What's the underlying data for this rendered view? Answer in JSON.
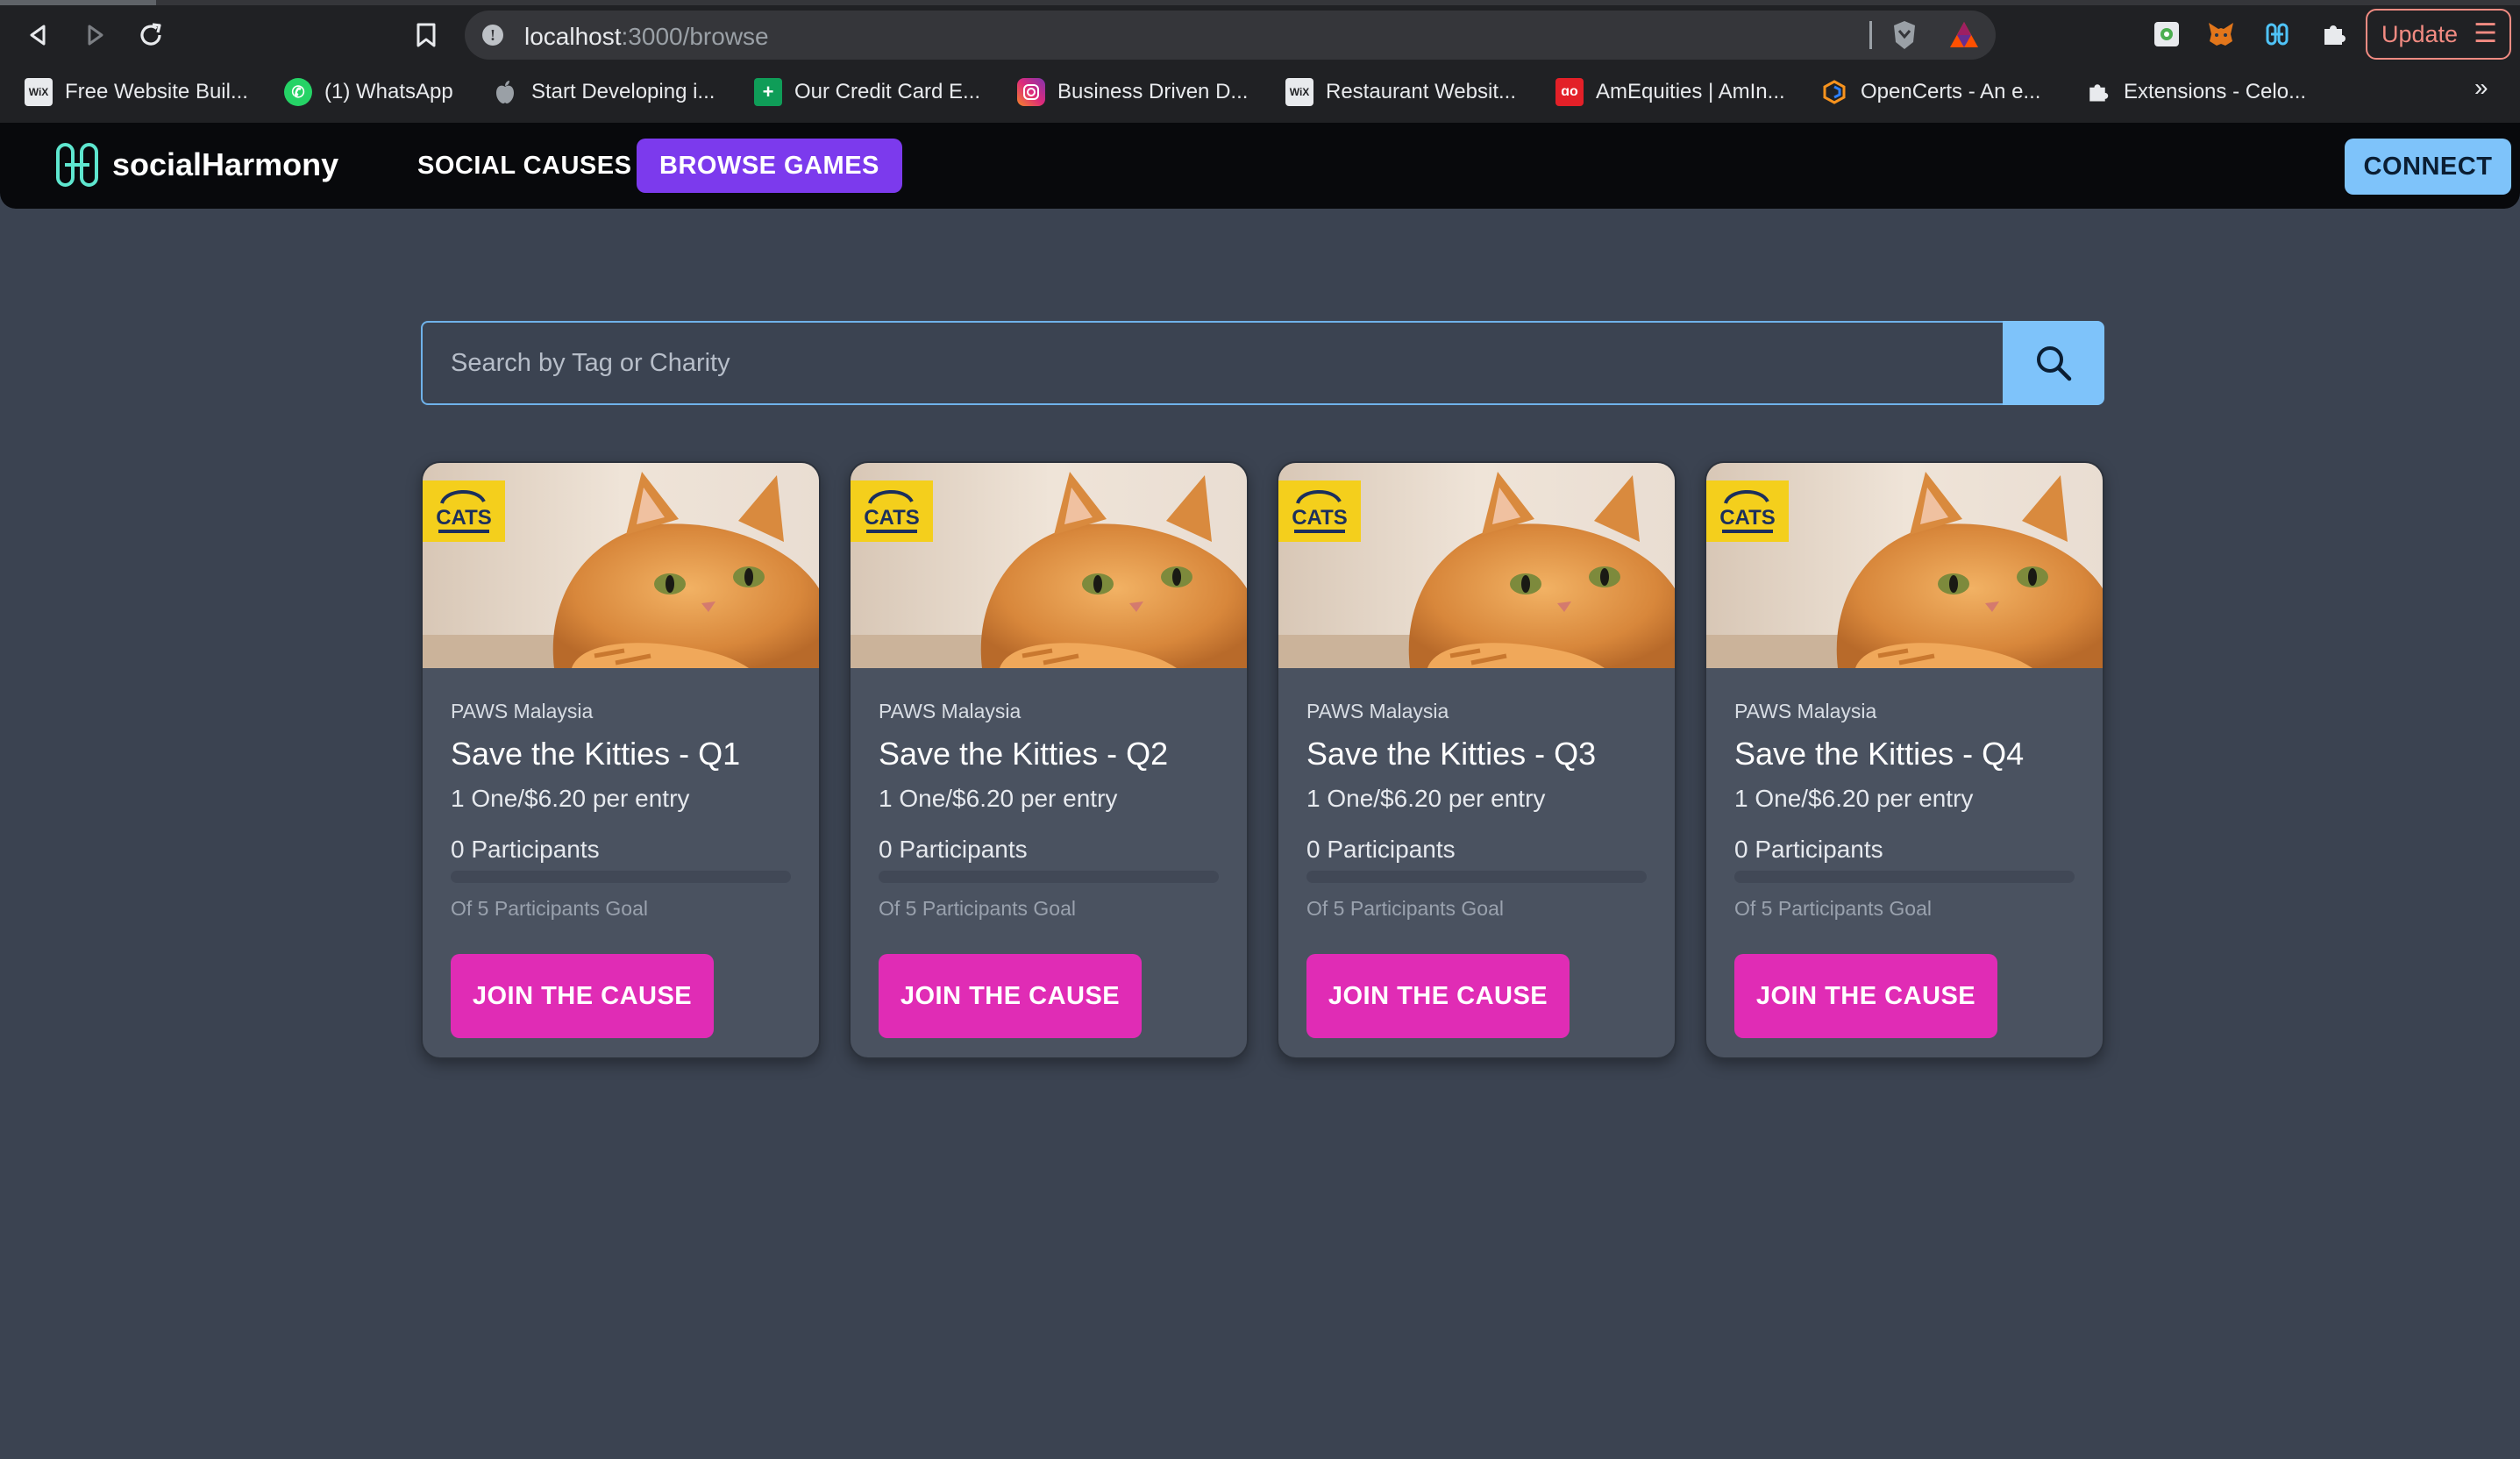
{
  "browser": {
    "url_host": "localhost",
    "url_path": ":3000/browse",
    "update_label": "Update",
    "bookmarks": [
      {
        "label": "Free Website Buil...",
        "icon": "wix-icon"
      },
      {
        "label": "(1) WhatsApp",
        "icon": "whatsapp-icon"
      },
      {
        "label": "Start Developing i...",
        "icon": "apple-icon"
      },
      {
        "label": "Our Credit Card E...",
        "icon": "sheets-icon"
      },
      {
        "label": "Business Driven D...",
        "icon": "instagram-icon"
      },
      {
        "label": "Restaurant Websit...",
        "icon": "wix-icon"
      },
      {
        "label": "AmEquities | AmIn...",
        "icon": "ambank-icon"
      },
      {
        "label": "OpenCerts - An e...",
        "icon": "opencerts-icon"
      },
      {
        "label": "Extensions - Celo...",
        "icon": "puzzle-icon"
      }
    ],
    "more_label": "»"
  },
  "app": {
    "brand": "socialHarmony",
    "nav": {
      "social_causes": "SOCIAL CAUSES",
      "browse_games": "BROWSE GAMES",
      "connect": "CONNECT"
    },
    "search": {
      "placeholder": "Search by Tag or Charity",
      "value": ""
    },
    "cards": [
      {
        "org": "PAWS Malaysia",
        "title": "Save the Kitties - Q1",
        "price": "1 One/$6.20 per entry",
        "participants": "0 Participants",
        "progress": 0,
        "goal": "Of 5 Participants Goal",
        "button": "JOIN THE CAUSE",
        "badge": "CATS"
      },
      {
        "org": "PAWS Malaysia",
        "title": "Save the Kitties - Q2",
        "price": "1 One/$6.20 per entry",
        "participants": "0 Participants",
        "progress": 0,
        "goal": "Of 5 Participants Goal",
        "button": "JOIN THE CAUSE",
        "badge": "CATS"
      },
      {
        "org": "PAWS Malaysia",
        "title": "Save the Kitties - Q3",
        "price": "1 One/$6.20 per entry",
        "participants": "0 Participants",
        "progress": 0,
        "goal": "Of 5 Participants Goal",
        "button": "JOIN THE CAUSE",
        "badge": "CATS"
      },
      {
        "org": "PAWS Malaysia",
        "title": "Save the Kitties - Q4",
        "price": "1 One/$6.20 per entry",
        "participants": "0 Participants",
        "progress": 0,
        "goal": "Of 5 Participants Goal",
        "button": "JOIN THE CAUSE",
        "badge": "CATS"
      }
    ]
  },
  "colors": {
    "page_bg": "#3b4351",
    "nav_bg": "#08090c",
    "active_nav": "#7c3aed",
    "connect": "#7ec3fa",
    "join": "#e02cb5",
    "card_bg": "#4a5260"
  }
}
